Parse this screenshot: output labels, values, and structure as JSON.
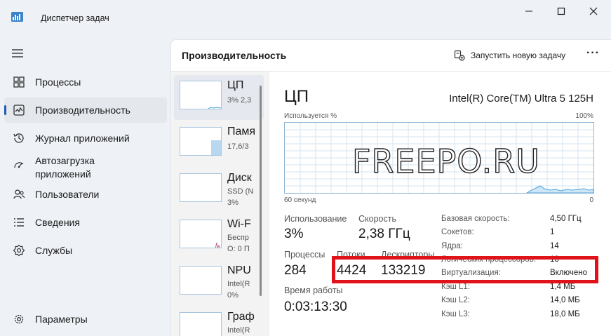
{
  "window": {
    "title": "Диспетчер задач",
    "minimize": "—",
    "maximize": "☐",
    "close": "✕"
  },
  "sidebar": {
    "items": [
      {
        "label": "Процессы",
        "icon": "grid-icon"
      },
      {
        "label": "Производительность",
        "icon": "performance-icon",
        "active": true
      },
      {
        "label": "Журнал приложений",
        "icon": "history-icon"
      },
      {
        "label": "Автозагрузка приложений",
        "icon": "startup-icon"
      },
      {
        "label": "Пользователи",
        "icon": "users-icon"
      },
      {
        "label": "Сведения",
        "icon": "details-icon"
      },
      {
        "label": "Службы",
        "icon": "services-icon"
      }
    ],
    "settings_label": "Параметры"
  },
  "header": {
    "title": "Производительность",
    "new_task_label": "Запустить новую задачу",
    "more_label": "···"
  },
  "resources": [
    {
      "name": "ЦП",
      "sub1": "3% 2,3",
      "sub2": ""
    },
    {
      "name": "Памя",
      "sub1": "17,6/3",
      "sub2": ""
    },
    {
      "name": "Диск",
      "sub1": "SSD (N",
      "sub2": "3%"
    },
    {
      "name": "Wi-F",
      "sub1": "Беспр",
      "sub2": "О: 0 П"
    },
    {
      "name": "NPU",
      "sub1": "Intel(R",
      "sub2": "0%"
    },
    {
      "name": "Граф",
      "sub1": "Intel(R",
      "sub2": ""
    }
  ],
  "detail": {
    "title": "ЦП",
    "model": "Intel(R) Core(TM) Ultra 5 125H",
    "graph_top_left": "Используется %",
    "graph_top_right": "100%",
    "graph_bottom_left": "60 секунд",
    "graph_bottom_right": "0",
    "watermark": "FREEPO.RU",
    "stats": {
      "usage_label": "Использование",
      "usage_value": "3%",
      "speed_label": "Скорость",
      "speed_value": "2,38 ГГц",
      "processes_label": "Процессы",
      "processes_value": "284",
      "threads_label": "Потоки",
      "threads_value": "4424",
      "handles_label": "Дескрипторы",
      "handles_value": "133219",
      "uptime_label": "Время работы",
      "uptime_value": "0:03:13:30"
    },
    "specs": [
      {
        "label": "Базовая скорость:",
        "value": "4,50 ГГц"
      },
      {
        "label": "Сокетов:",
        "value": "1"
      },
      {
        "label": "Ядра:",
        "value": "14"
      },
      {
        "label": "Логических процессоров:",
        "value": "18"
      },
      {
        "label": "Виртуализация:",
        "value": "Включено"
      },
      {
        "label": "Кэш L1:",
        "value": "1,4 МБ"
      },
      {
        "label": "Кэш L2:",
        "value": "14,0 МБ"
      },
      {
        "label": "Кэш L3:",
        "value": "18,0 МБ"
      }
    ]
  },
  "colors": {
    "accent": "#1a5fb4",
    "graph_line": "#4aa3df",
    "highlight": "#e0121a"
  }
}
